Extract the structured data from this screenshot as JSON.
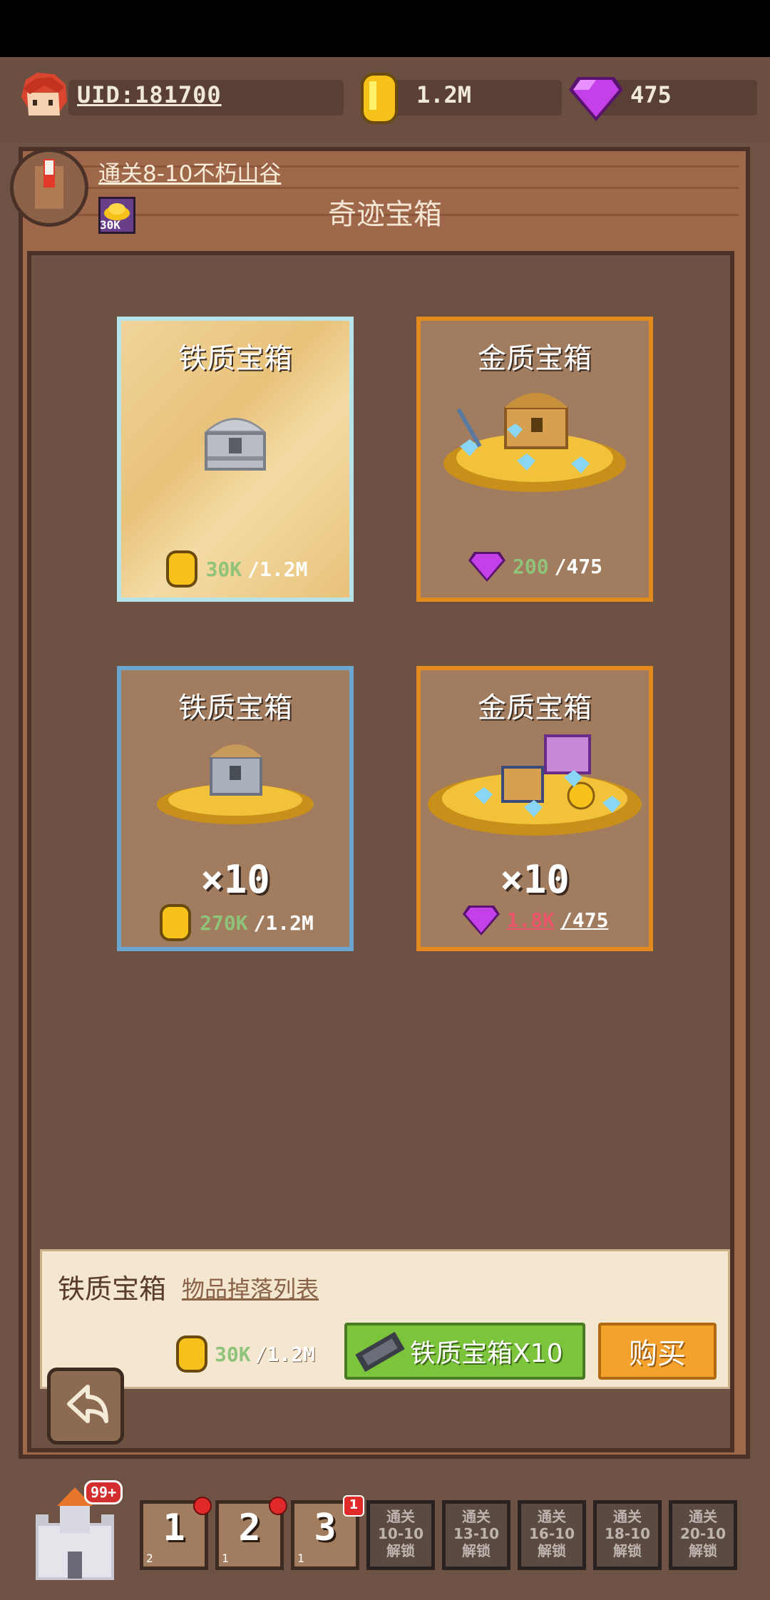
{
  "status_bar": {},
  "header": {
    "uid": "UID:181700",
    "coins": "1.2M",
    "gems": "475"
  },
  "quest": {
    "text": "通关8-10不朽山谷",
    "reward": "30K"
  },
  "title": "奇迹宝箱",
  "cards": [
    {
      "title": "铁质宝箱",
      "multiplier": "",
      "cost": "30K",
      "owned": "/1.2M",
      "currency": "coin"
    },
    {
      "title": "金质宝箱",
      "multiplier": "",
      "cost": "200",
      "owned": "/475",
      "currency": "gem"
    },
    {
      "title": "铁质宝箱",
      "multiplier": "×10",
      "cost": "270K",
      "owned": "/1.2M",
      "currency": "coin"
    },
    {
      "title": "金质宝箱",
      "multiplier": "×10",
      "cost": "1.8K",
      "owned": "/475",
      "currency": "gem"
    }
  ],
  "info": {
    "title": "铁质宝箱",
    "link": "物品掉落列表",
    "cost": "30K",
    "owned": "/1.2M",
    "ticket_button": "铁质宝箱X10",
    "buy_button": "购买"
  },
  "bottom_nav": {
    "castle_badge": "99+",
    "slots": [
      {
        "num": "1",
        "sub": "2"
      },
      {
        "num": "2",
        "sub": "1"
      },
      {
        "num": "3",
        "sub": "1",
        "badge": "1"
      }
    ],
    "locked": [
      {
        "line1": "通关",
        "line2": "10-10",
        "line3": "解锁"
      },
      {
        "line1": "通关",
        "line2": "13-10",
        "line3": "解锁"
      },
      {
        "line1": "通关",
        "line2": "16-10",
        "line3": "解锁"
      },
      {
        "line1": "通关",
        "line2": "18-10",
        "line3": "解锁"
      },
      {
        "line1": "通关",
        "line2": "20-10",
        "line3": "解锁"
      }
    ]
  },
  "colors": {
    "background": "#6e5344",
    "wood": "#a0684a",
    "gold_border": "#e48a1f",
    "blue_border": "#6aa6cf",
    "green_button": "#7cc43c",
    "orange_button": "#f4a22e"
  }
}
